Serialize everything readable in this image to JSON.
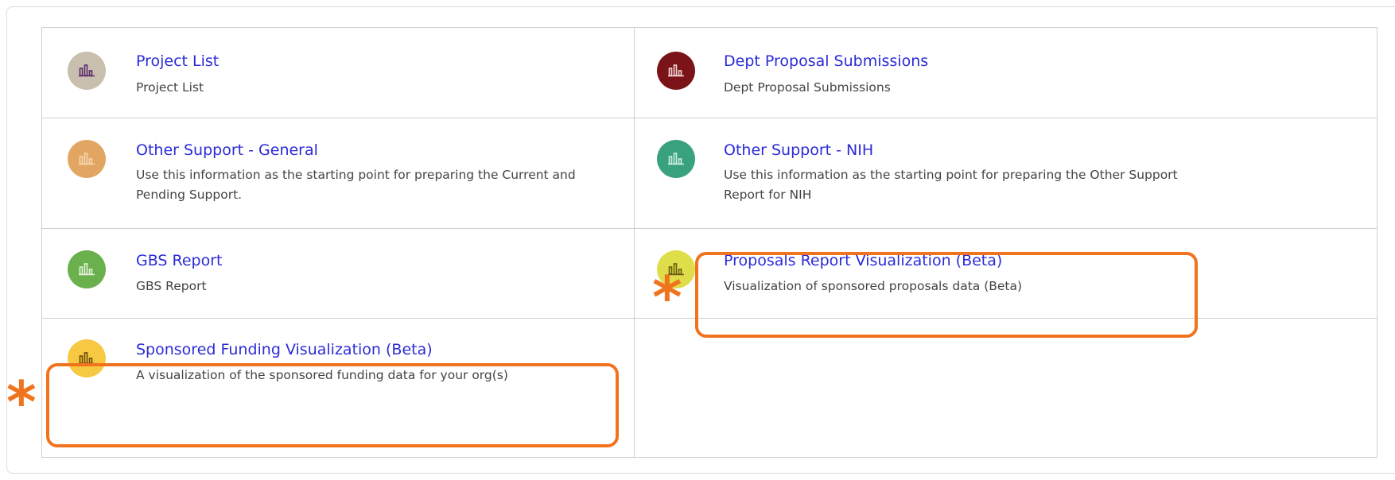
{
  "reports": [
    {
      "title": "Project List",
      "description": "Project List",
      "icon_color": "#c8bfae",
      "bar_color": "#5a2a6a"
    },
    {
      "title": "Dept Proposal Submissions",
      "description": "Dept Proposal Submissions",
      "icon_color": "#7a1418",
      "bar_color": "#f3d7d7"
    },
    {
      "title": "Other Support - General",
      "description": "Use this information as the starting point for preparing the Current and Pending Support.",
      "icon_color": "#e3a662",
      "bar_color": "#f5d6b0"
    },
    {
      "title": "Other Support - NIH",
      "description": "Use this information as the starting point for preparing the Other Support Report for NIH",
      "icon_color": "#3aa17e",
      "bar_color": "#cdeee0"
    },
    {
      "title": "GBS Report",
      "description": "GBS Report",
      "icon_color": "#6ab04c",
      "bar_color": "#e3f3da"
    },
    {
      "title": "Proposals Report Visualization (Beta)",
      "description": "Visualization of sponsored proposals data (Beta)",
      "icon_color": "#dede4a",
      "bar_color": "#6a5a10"
    },
    {
      "title": "Sponsored Funding Visualization (Beta)",
      "description": "A visualization of the sponsored funding data for your org(s)",
      "icon_color": "#f7c842",
      "bar_color": "#6a4a08"
    }
  ],
  "annotations": {
    "asterisk_symbol": "*",
    "highlight_color": "#f0731e"
  }
}
